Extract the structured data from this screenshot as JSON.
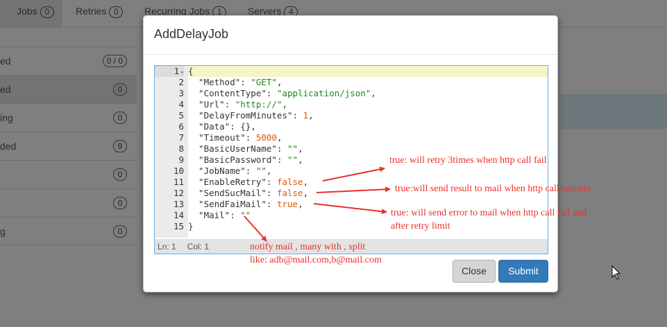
{
  "tabs": [
    {
      "label": "Jobs",
      "count": "0"
    },
    {
      "label": "Retries",
      "count": "0"
    },
    {
      "label": "Recurring Jobs",
      "count": "1"
    },
    {
      "label": "Servers",
      "count": "4"
    }
  ],
  "sidebar": {
    "items": [
      {
        "label": "ed",
        "count": "0 / 0"
      },
      {
        "label": "ed",
        "count": "0"
      },
      {
        "label": "ing",
        "count": "0"
      },
      {
        "label": "ded",
        "count": "9"
      },
      {
        "label": "",
        "count": "0"
      },
      {
        "label": "",
        "count": "0"
      },
      {
        "label": "g",
        "count": "0"
      }
    ]
  },
  "modal": {
    "title": "AddDelayJob",
    "close_label": "Close",
    "submit_label": "Submit"
  },
  "editor": {
    "line_numbers": [
      "1",
      "2",
      "3",
      "4",
      "5",
      "6",
      "7",
      "8",
      "9",
      "10",
      "11",
      "12",
      "13",
      "14",
      "15"
    ],
    "code": {
      "l1": "{",
      "l2_key": "  \"Method\"",
      "l2_val": "\"GET\"",
      "l3_key": "  \"ContentType\"",
      "l3_val": "\"application/json\"",
      "l4_key": "  \"Url\"",
      "l4_val": "\"http://\"",
      "l5_key": "  \"DelayFromMinutes\"",
      "l5_val": "1",
      "l6_key": "  \"Data\"",
      "l6_val": "{}",
      "l7_key": "  \"Timeout\"",
      "l7_val": "5000",
      "l8_key": "  \"BasicUserName\"",
      "l8_val": "\"\"",
      "l9_key": "  \"BasicPassword\"",
      "l9_val": "\"\"",
      "l10_key": "  \"JobName\"",
      "l10_val": "\"\"",
      "l11_key": "  \"EnableRetry\"",
      "l11_val": "false",
      "l12_key": "  \"SendSucMail\"",
      "l12_val": "false",
      "l13_key": "  \"SendFaiMail\"",
      "l13_val": "true",
      "l14_key": "  \"Mail\"",
      "l14_val": "\"\"",
      "l15": "}"
    },
    "status": {
      "ln": "Ln: 1",
      "col": "Col: 1"
    }
  },
  "annotations": {
    "retry": "true: will retry 3times when http call fail",
    "suc_mail": "true:will send result to mail when http call success",
    "fai_mail_1": "true: will send error to mail when http call fail and",
    "fai_mail_2": "after retry limit",
    "mail_1": "notify mail , many with , split",
    "mail_2": "like: adb@mail.com,b@mail.com",
    "color": "#e8302a"
  }
}
